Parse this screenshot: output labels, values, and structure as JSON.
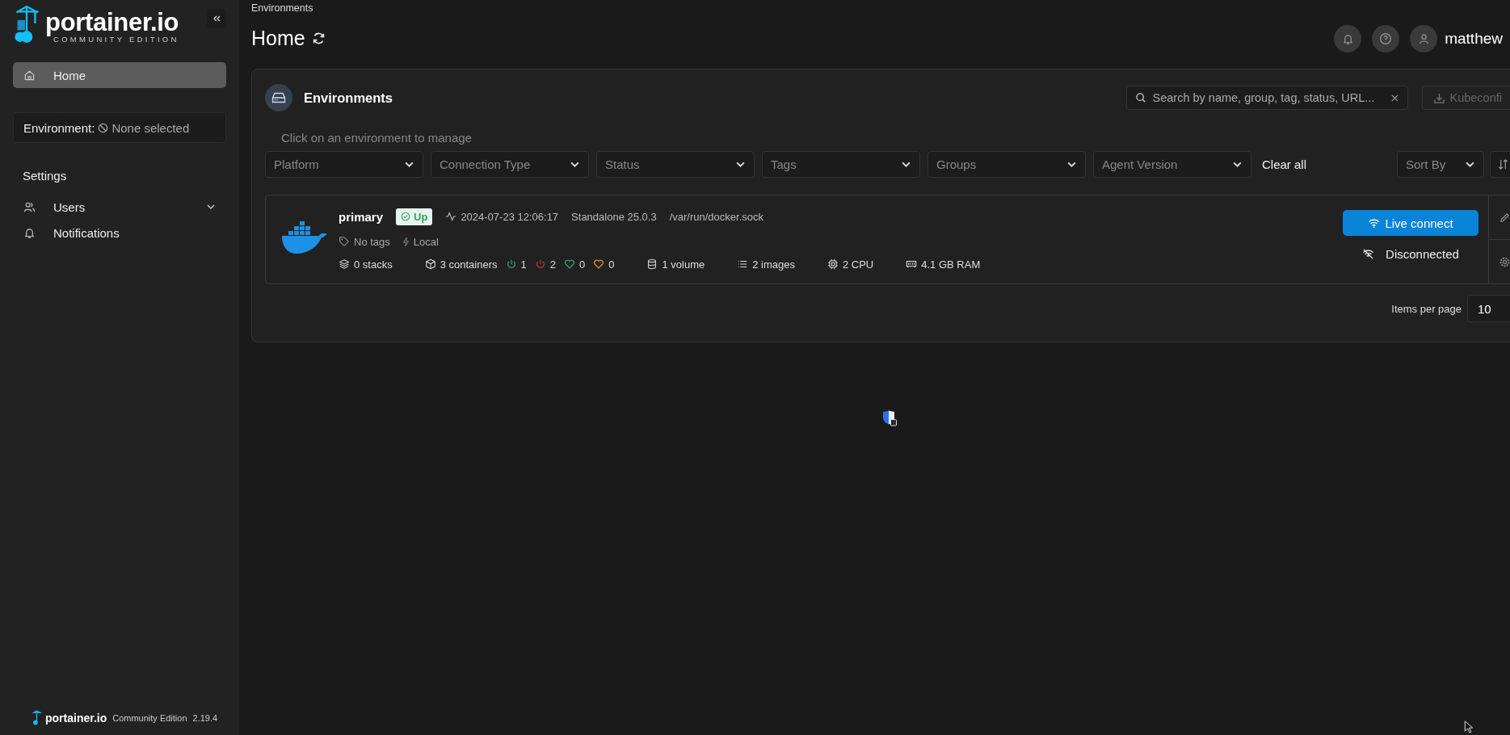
{
  "sidebar": {
    "logo": {
      "name": "portainer.io",
      "edition": "COMMUNITY EDITION"
    },
    "nav": [
      {
        "label": "Home",
        "selected": true
      }
    ],
    "environment": {
      "label": "Environment:",
      "value": "None selected"
    },
    "settings": {
      "title": "Settings",
      "items": [
        {
          "label": "Users",
          "kind": "users",
          "expanded": false
        },
        {
          "label": "Notifications",
          "kind": "bell"
        }
      ]
    },
    "footer": {
      "name": "portainer.io",
      "edition": "Community Edition",
      "version": "2.19.4"
    }
  },
  "breadcrumb": "Environments",
  "page_title": "Home",
  "user": {
    "name": "matthew"
  },
  "environments_panel": {
    "title": "Environments",
    "search": {
      "placeholder": "Search by name, group, tag, status, URL..."
    },
    "kubeconfig_button": "Kubeconfi",
    "hint": "Click on an environment to manage",
    "filters": [
      {
        "placeholder": "Platform"
      },
      {
        "placeholder": "Connection Type"
      },
      {
        "placeholder": "Status"
      },
      {
        "placeholder": "Tags"
      },
      {
        "placeholder": "Groups"
      },
      {
        "placeholder": "Agent Version"
      }
    ],
    "clear_all": "Clear all",
    "sort": {
      "placeholder": "Sort By"
    },
    "environments": [
      {
        "name": "primary",
        "status": "Up",
        "heartbeat": "2024-07-23 12:06:17",
        "type": "Standalone 25.0.3",
        "url": "/var/run/docker.sock",
        "tags": "No tags",
        "connection": "Local",
        "stats": [
          {
            "kind": "stacks",
            "text": "0 stacks"
          },
          {
            "kind": "containers",
            "text": "3 containers"
          },
          {
            "kind": "running",
            "text": "1"
          },
          {
            "kind": "stopped",
            "text": "2"
          },
          {
            "kind": "healthy",
            "text": "0"
          },
          {
            "kind": "unhealthy",
            "text": "0"
          },
          {
            "kind": "volumes",
            "text": "1 volume"
          },
          {
            "kind": "images",
            "text": "2 images"
          },
          {
            "kind": "cpu",
            "text": "2 CPU"
          },
          {
            "kind": "ram",
            "text": "4.1 GB RAM"
          }
        ],
        "live_connect": "Live connect",
        "connection_state": "Disconnected"
      }
    ],
    "pagination": {
      "label": "Items per page",
      "value": "10"
    }
  }
}
